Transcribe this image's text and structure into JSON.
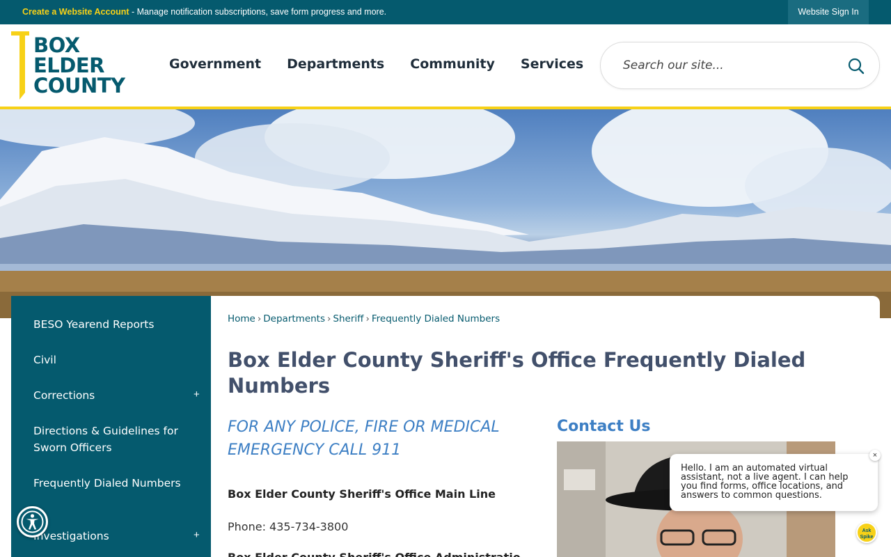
{
  "topbar": {
    "account_link": "Create a Website Account",
    "account_desc": " - Manage notification subscriptions, save form progress and more.",
    "signin": "Website Sign In"
  },
  "logo": {
    "line1": "BOX",
    "line2": "ELDER",
    "line3": "COUNTY"
  },
  "nav": {
    "items": [
      "Government",
      "Departments",
      "Community",
      "Services"
    ]
  },
  "search": {
    "placeholder": "Search our site..."
  },
  "sidebar": {
    "items": [
      {
        "label": "BESO Yearend Reports",
        "expandable": false
      },
      {
        "label": "Civil",
        "expandable": false
      },
      {
        "label": "Corrections",
        "expandable": true
      },
      {
        "label": "Directions & Guidelines for Sworn Officers",
        "expandable": false
      },
      {
        "label": "Frequently Dialed Numbers",
        "expandable": false
      },
      {
        "label": "Investigations",
        "expandable": true
      }
    ],
    "plus": "+"
  },
  "breadcrumb": {
    "items": [
      "Home",
      "Departments",
      "Sheriff",
      "Frequently Dialed Numbers"
    ],
    "separator": "›"
  },
  "content": {
    "title": "Box Elder County Sheriff's Office Frequently Dialed Numbers",
    "emergency": "FOR ANY POLICE, FIRE OR MEDICAL EMERGENCY CALL 911",
    "main_line_heading": "Box Elder County Sheriff's Office Main Line",
    "main_line_phone": "Phone: 435-734-3800",
    "admin_heading": "Box Elder County Sheriff's Office Administration",
    "contact_heading": "Contact Us"
  },
  "chat": {
    "message": "Hello. I am an automated virtual assistant, not a live agent. I can help you find forms, office locations, and answers to common questions.",
    "close": "×",
    "launcher": "Ask Spike"
  },
  "colors": {
    "brand_teal": "#055a6e",
    "brand_yellow": "#f7d117",
    "heading_blue": "#3d7fc4",
    "title_slate": "#42506b"
  }
}
